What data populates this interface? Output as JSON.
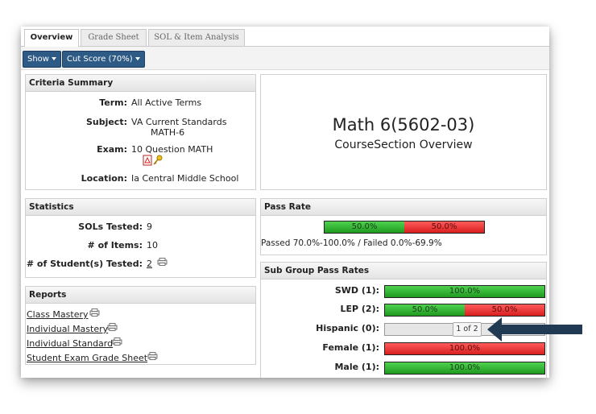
{
  "tabs": [
    {
      "label": "Overview"
    },
    {
      "label": "Grade Sheet"
    },
    {
      "label": "SOL & Item Analysis"
    }
  ],
  "toolbar": {
    "show_label": "Show",
    "cut_score_label": "Cut Score (70%)"
  },
  "criteria": {
    "heading": "Criteria Summary",
    "term_label": "Term:",
    "term_value": "All Active Terms",
    "subject_label": "Subject:",
    "subject_value_1": "VA Current Standards",
    "subject_value_2": "MATH-6",
    "exam_label": "Exam:",
    "exam_value": "10 Question MATH",
    "location_label": "Location:",
    "location_value": "Ia Central Middle School"
  },
  "overview": {
    "title": "Math 6(5602-03)",
    "subtitle": "CourseSection Overview"
  },
  "statistics": {
    "heading": "Statistics",
    "sols_label": "SOLs Tested:",
    "sols_value": "9",
    "items_label": "# of Items:",
    "items_value": "10",
    "students_label": "# of Student(s) Tested:",
    "students_value": "2"
  },
  "pass_rate": {
    "heading": "Pass Rate",
    "passed_pct": 50.0,
    "failed_pct": 50.0,
    "passed_label": "50.0%",
    "failed_label": "50.0%",
    "legend": "Passed 70.0%-100.0% / Failed 0.0%-69.9%"
  },
  "reports": {
    "heading": "Reports",
    "items": [
      {
        "label": "Class Mastery"
      },
      {
        "label": "Individual Mastery"
      },
      {
        "label": "Individual Standard"
      },
      {
        "label": "Student Exam Grade Sheet"
      }
    ]
  },
  "subgroups": {
    "heading": "Sub Group Pass Rates",
    "rows": [
      {
        "label": "SWD (1):",
        "passed": 100.0,
        "failed": 0,
        "passed_label": "100.0%",
        "failed_label": ""
      },
      {
        "label": "LEP (2):",
        "passed": 50.0,
        "failed": 50.0,
        "passed_label": "50.0%",
        "failed_label": "50.0%"
      },
      {
        "label": "Hispanic (0):",
        "passed": 0,
        "failed": 0,
        "passed_label": "",
        "failed_label": ""
      },
      {
        "label": "Female (1):",
        "passed": 0,
        "failed": 100.0,
        "passed_label": "",
        "failed_label": "100.0%"
      },
      {
        "label": "Male (1):",
        "passed": 100.0,
        "failed": 0,
        "passed_label": "100.0%",
        "failed_label": ""
      }
    ],
    "tooltip": "1 of 2"
  },
  "colors": {
    "pass": "#2fb52f",
    "fail": "#e02a2a",
    "toolbar_button": "#2e5a86",
    "arrow": "#1f3a52"
  },
  "icons": {
    "print": "printer-icon",
    "pdf": "pdf-icon",
    "key": "key-icon"
  }
}
